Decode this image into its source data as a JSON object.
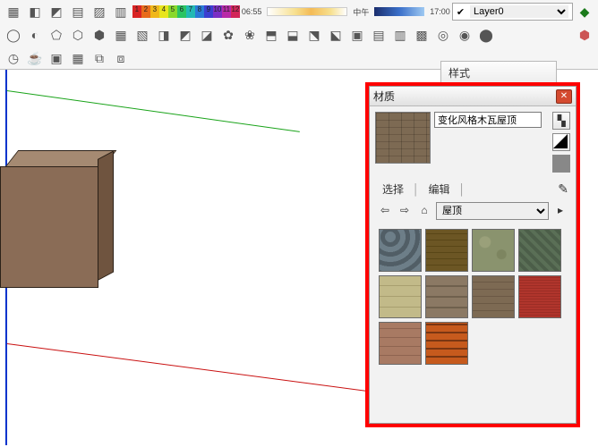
{
  "layer": {
    "selected": "Layer0"
  },
  "spectrum_labels": [
    "1",
    "2",
    "3",
    "4",
    "5",
    "6",
    "7",
    "8",
    "9",
    "10",
    "11",
    "12"
  ],
  "time": {
    "start": "06:55",
    "mid": "中午",
    "end": "17:00"
  },
  "styles_tab": {
    "label": "样式"
  },
  "materials": {
    "title": "材质",
    "material_name": "变化风格木瓦屋顶",
    "tabs": {
      "select": "选择",
      "edit": "编辑"
    },
    "category": "屋顶"
  },
  "thumbs": [
    {
      "bg": "repeating-radial-gradient(circle at 12px 8px,#6d7e88 0 6px,#515e66 6px 11px),#6d7e88"
    },
    {
      "bg": "repeating-linear-gradient(0deg,#6c5624 0 6px,#594617 6px 7px),repeating-linear-gradient(90deg,rgba(0,0,0,.2) 0 1px,transparent 1px 12px)"
    },
    {
      "bg": "radial-gradient(circle at 30% 30%,#9aa07a 0 6px,transparent 7px),radial-gradient(circle at 70% 60%,#7d8560 0 5px,transparent 6px),#8a936e"
    },
    {
      "bg": "repeating-linear-gradient(45deg,#5a6f56 0 4px,#4c5e49 4px 8px)"
    },
    {
      "bg": "repeating-linear-gradient(0deg,#c2ba89 0 11px,#a89f6f 11px 12px),repeating-linear-gradient(90deg,rgba(0,0,0,.15) 0 1px,transparent 1px 11px)"
    },
    {
      "bg": "repeating-linear-gradient(0deg,#8b7964 0 10px,#6f604d 10px 12px)"
    },
    {
      "bg": "repeating-linear-gradient(0deg,#7d6a53 0 7px,#6b5945 7px 8px),repeating-linear-gradient(90deg,rgba(0,0,0,.18) 0 1px,transparent 1px 14px)"
    },
    {
      "bg": "repeating-linear-gradient(0deg,#b0352c 0 2px,#9c2d25 2px 3px)"
    },
    {
      "bg": "repeating-linear-gradient(0deg,#a87a63 0 9px,#8e6450 9px 10px)"
    },
    {
      "bg": "repeating-linear-gradient(0deg,#c65a1d 0 7px,#7a3612 7px 9px),repeating-linear-gradient(90deg,rgba(0,0,0,.3) 0 1px,transparent 1px 9px)"
    }
  ]
}
